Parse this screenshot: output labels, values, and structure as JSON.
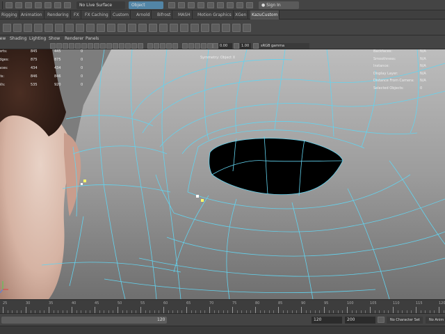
{
  "status_line": {
    "live_surface": "No Live Surface",
    "object_select": "Object",
    "sign_in": "Sign In"
  },
  "shelf_tabs": [
    {
      "label": "Rigging",
      "active": false
    },
    {
      "label": "Animation",
      "active": false
    },
    {
      "label": "Rendering",
      "active": false
    },
    {
      "label": "FX",
      "active": false
    },
    {
      "label": "FX Caching",
      "active": false
    },
    {
      "label": "Custom",
      "active": false
    },
    {
      "label": "Arnold",
      "active": false
    },
    {
      "label": "Bifrost",
      "active": false
    },
    {
      "label": "MASH",
      "active": false
    },
    {
      "label": "Motion Graphics",
      "active": false
    },
    {
      "label": "XGen",
      "active": false
    },
    {
      "label": "KazuCustom",
      "active": true
    }
  ],
  "panel_menu": [
    "View",
    "Shading",
    "Lighting",
    "Show",
    "Renderer",
    "Panels"
  ],
  "panel_toolbar": {
    "exposure": "0.00",
    "gamma": "1.00",
    "color_space": "sRGB gamma"
  },
  "hud_left": {
    "rows": [
      {
        "label": "Verts:",
        "v1": "845",
        "v2": "445",
        "v3": "0"
      },
      {
        "label": "Edges:",
        "v2": "875",
        "v1": "875",
        "v3": "0"
      },
      {
        "label": "Faces:",
        "v1": "434",
        "v2": "434",
        "v3": "0"
      },
      {
        "label": "Tris:",
        "v1": "846",
        "v2": "846",
        "v3": "0"
      },
      {
        "label": "UVs:",
        "v1": "535",
        "v2": "920",
        "v3": "0"
      }
    ]
  },
  "hud_center": "Symmetry: Object X",
  "hud_right": {
    "rows": [
      {
        "label": "Backfaces:",
        "value": "N/A"
      },
      {
        "label": "Smoothness:",
        "value": "N/A"
      },
      {
        "label": "Instance:",
        "value": "N/A"
      },
      {
        "label": "Display Layer:",
        "value": "N/A"
      },
      {
        "label": "Distance From Camera:",
        "value": "N/A"
      },
      {
        "label": "Selected Objects:",
        "value": "0"
      }
    ]
  },
  "timeline": {
    "ticks": [
      "25",
      "30",
      "35",
      "40",
      "45",
      "50",
      "55",
      "60",
      "65",
      "70",
      "75",
      "80",
      "85",
      "90",
      "95",
      "100",
      "105",
      "110",
      "115",
      "120"
    ]
  },
  "range": {
    "slider_end": "120",
    "anim_end": "120",
    "max_time": "200",
    "character_set": "No Character Set",
    "anim_layer": "No Anim"
  },
  "colors": {
    "wire": "#62d4f0",
    "ui_bg": "#444444",
    "accent_blue": "#5285a6"
  }
}
